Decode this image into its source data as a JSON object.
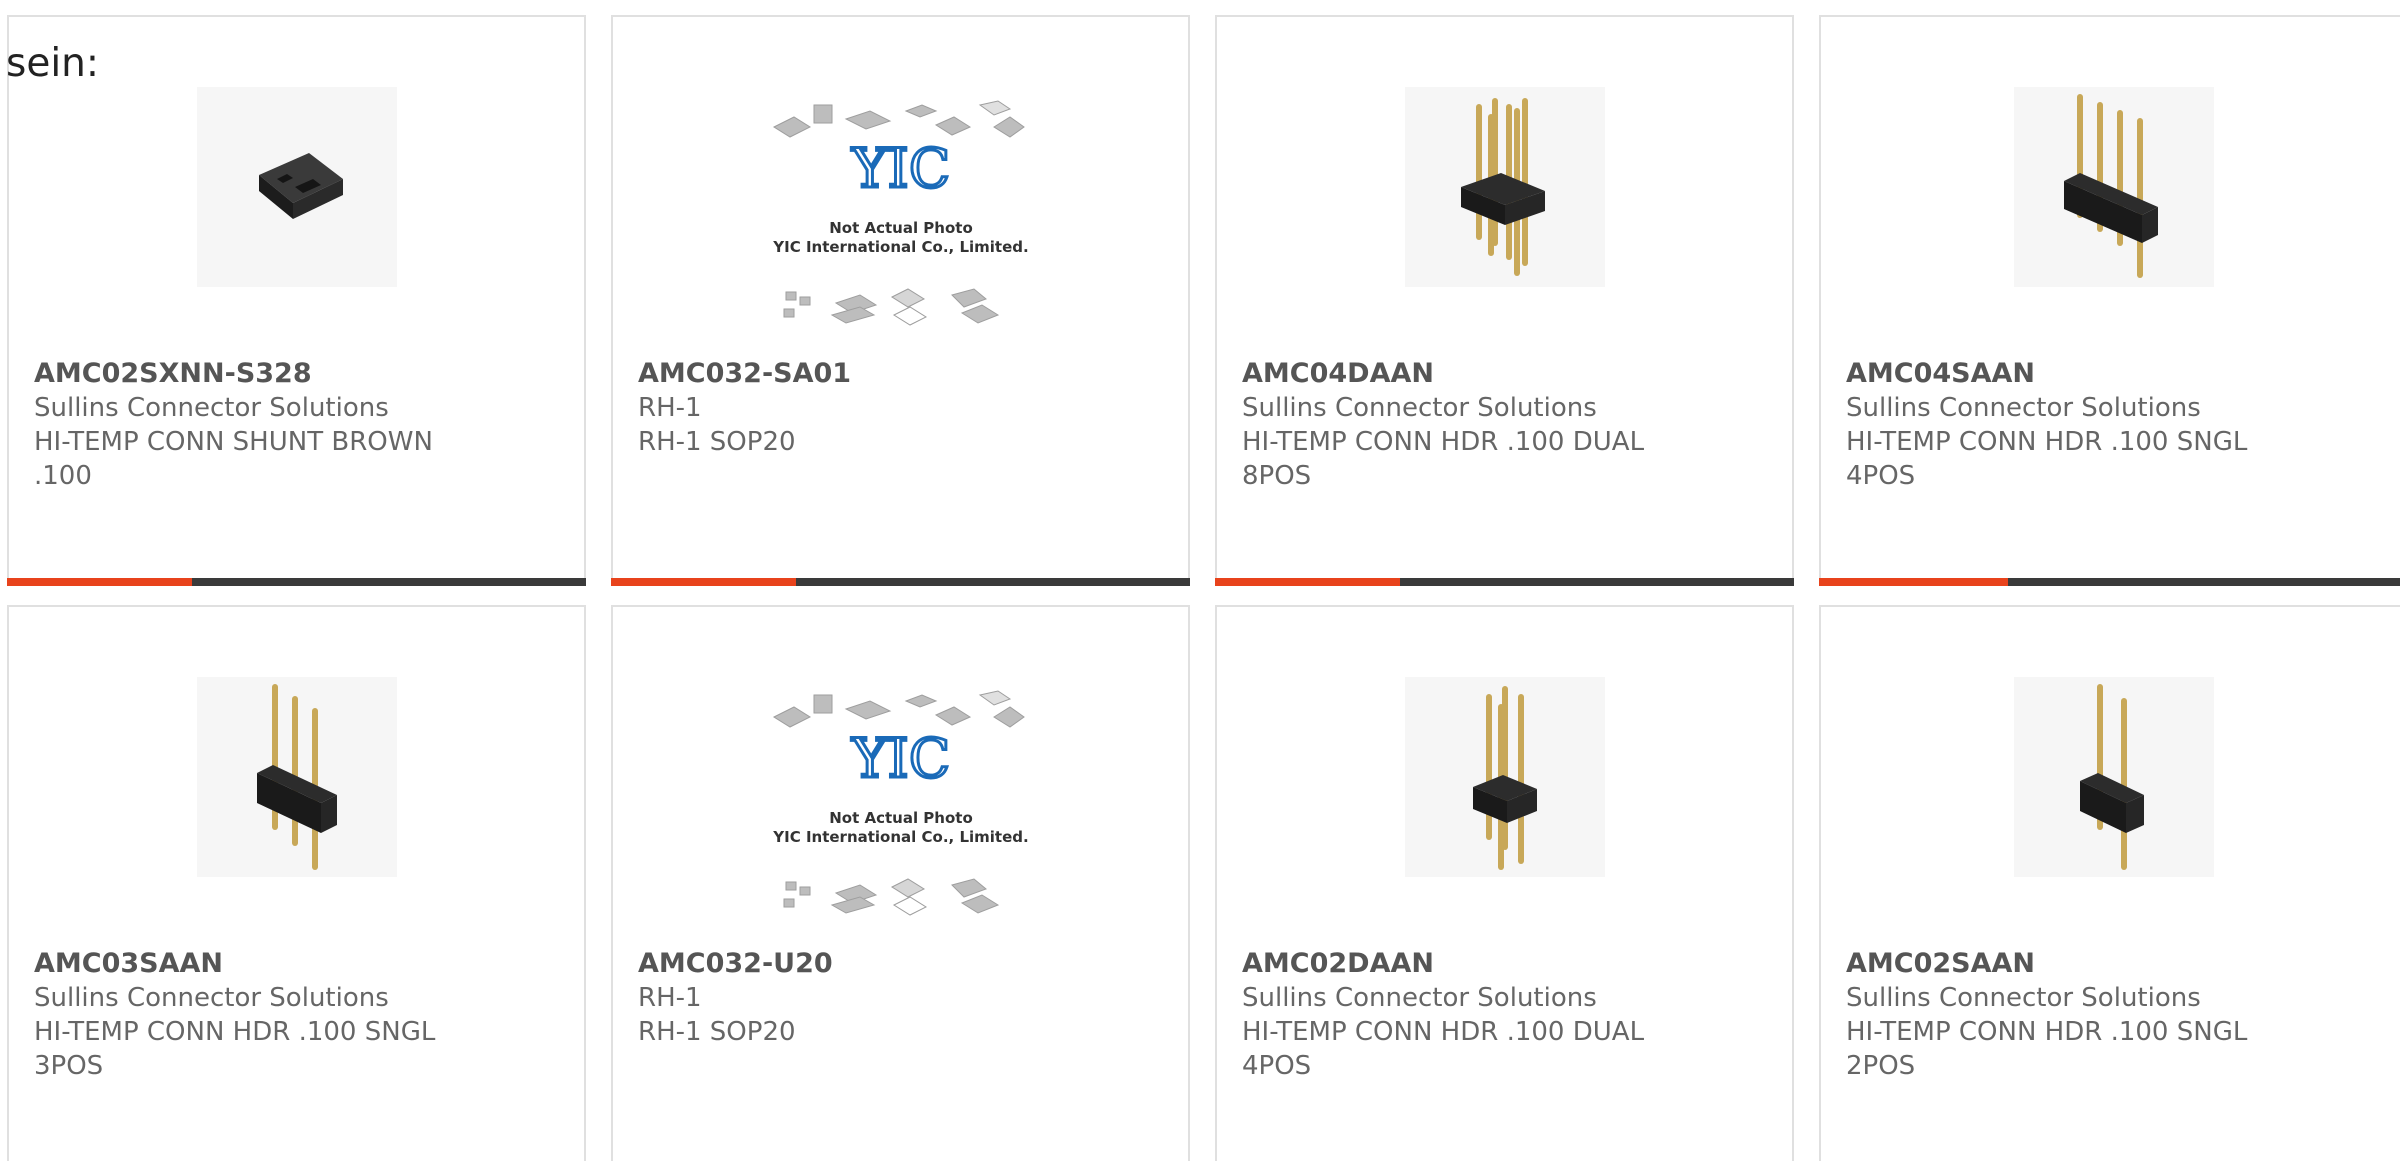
{
  "page": {
    "intro_text": "sein:"
  },
  "colors": {
    "accent": "#e8431c",
    "track": "#3a3a3a",
    "border": "#e0e0e0",
    "text": "#666666"
  },
  "products": [
    {
      "part_number": "AMC02SXNN-S328",
      "manufacturer": "Sullins Connector Solutions",
      "desc_line1": "HI-TEMP CONN SHUNT BROWN",
      "desc_line2": ".100",
      "image_icon": "shunt-jumper-icon",
      "progress": 0.32
    },
    {
      "part_number": "AMC032-SA01",
      "manufacturer": "RH-1",
      "desc_line1": "RH-1 SOP20",
      "desc_line2": "",
      "image_icon": "placeholder-chips-icon",
      "placeholder_text1": "Not Actual Photo",
      "placeholder_text2": "YIC International Co., Limited.",
      "placeholder_logo": "YIC",
      "progress": 0.32
    },
    {
      "part_number": "AMC04DAAN",
      "manufacturer": "Sullins Connector Solutions",
      "desc_line1": "HI-TEMP CONN HDR .100 DUAL",
      "desc_line2": "8POS",
      "image_icon": "dual-pin-header-icon",
      "progress": 0.32
    },
    {
      "part_number": "AMC04SAAN",
      "manufacturer": "Sullins Connector Solutions",
      "desc_line1": "HI-TEMP CONN HDR .100 SNGL",
      "desc_line2": "4POS",
      "image_icon": "single-pin-header-icon",
      "progress": 0.32
    },
    {
      "part_number": "AMC03SAAN",
      "manufacturer": "Sullins Connector Solutions",
      "desc_line1": "HI-TEMP CONN HDR .100 SNGL",
      "desc_line2": "3POS",
      "image_icon": "single-pin-header-icon"
    },
    {
      "part_number": "AMC032-U20",
      "manufacturer": "RH-1",
      "desc_line1": "RH-1 SOP20",
      "desc_line2": "",
      "image_icon": "placeholder-chips-icon",
      "placeholder_text1": "Not Actual Photo",
      "placeholder_text2": "YIC International Co., Limited.",
      "placeholder_logo": "YIC"
    },
    {
      "part_number": "AMC02DAAN",
      "manufacturer": "Sullins Connector Solutions",
      "desc_line1": "HI-TEMP CONN HDR .100 DUAL",
      "desc_line2": "4POS",
      "image_icon": "dual-pin-header-icon"
    },
    {
      "part_number": "AMC02SAAN",
      "manufacturer": "Sullins Connector Solutions",
      "desc_line1": "HI-TEMP CONN HDR .100 SNGL",
      "desc_line2": "2POS",
      "image_icon": "single-pin-header-icon"
    }
  ]
}
